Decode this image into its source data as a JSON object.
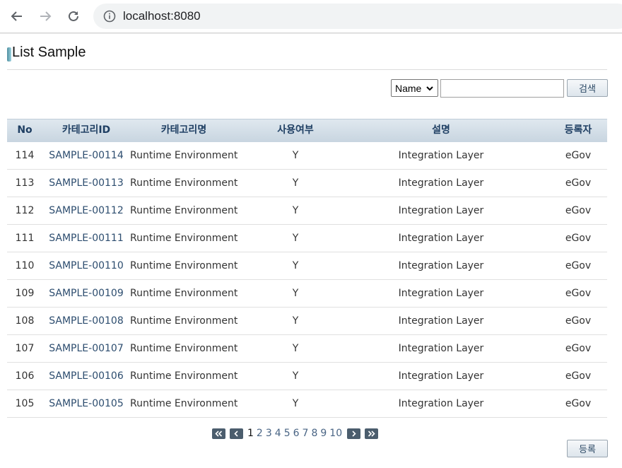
{
  "browser": {
    "url": "localhost:8080",
    "icons": {
      "back": "arrow-left-icon",
      "forward": "arrow-right-icon",
      "reload": "reload-icon",
      "info": "info-icon"
    }
  },
  "page": {
    "title": "List Sample"
  },
  "search": {
    "condition_selected": "Name",
    "keyword_value": "",
    "button_label": "검색"
  },
  "table": {
    "headers": [
      "No",
      "카테고리ID",
      "카테고리명",
      "사용여부",
      "설명",
      "등록자"
    ],
    "rows": [
      {
        "no": "114",
        "id": "SAMPLE-00114",
        "name": "Runtime Environment",
        "use": "Y",
        "desc": "Integration Layer",
        "reg": "eGov"
      },
      {
        "no": "113",
        "id": "SAMPLE-00113",
        "name": "Runtime Environment",
        "use": "Y",
        "desc": "Integration Layer",
        "reg": "eGov"
      },
      {
        "no": "112",
        "id": "SAMPLE-00112",
        "name": "Runtime Environment",
        "use": "Y",
        "desc": "Integration Layer",
        "reg": "eGov"
      },
      {
        "no": "111",
        "id": "SAMPLE-00111",
        "name": "Runtime Environment",
        "use": "Y",
        "desc": "Integration Layer",
        "reg": "eGov"
      },
      {
        "no": "110",
        "id": "SAMPLE-00110",
        "name": "Runtime Environment",
        "use": "Y",
        "desc": "Integration Layer",
        "reg": "eGov"
      },
      {
        "no": "109",
        "id": "SAMPLE-00109",
        "name": "Runtime Environment",
        "use": "Y",
        "desc": "Integration Layer",
        "reg": "eGov"
      },
      {
        "no": "108",
        "id": "SAMPLE-00108",
        "name": "Runtime Environment",
        "use": "Y",
        "desc": "Integration Layer",
        "reg": "eGov"
      },
      {
        "no": "107",
        "id": "SAMPLE-00107",
        "name": "Runtime Environment",
        "use": "Y",
        "desc": "Integration Layer",
        "reg": "eGov"
      },
      {
        "no": "106",
        "id": "SAMPLE-00106",
        "name": "Runtime Environment",
        "use": "Y",
        "desc": "Integration Layer",
        "reg": "eGov"
      },
      {
        "no": "105",
        "id": "SAMPLE-00105",
        "name": "Runtime Environment",
        "use": "Y",
        "desc": "Integration Layer",
        "reg": "eGov"
      }
    ]
  },
  "pagination": {
    "pages": [
      "1",
      "2",
      "3",
      "4",
      "5",
      "6",
      "7",
      "8",
      "9",
      "10"
    ],
    "current": "1",
    "icons": {
      "first": "double-chevron-left-icon",
      "prev": "chevron-left-icon",
      "next": "chevron-right-icon",
      "last": "double-chevron-right-icon"
    }
  },
  "actions": {
    "register_label": "등록"
  },
  "colors": {
    "header_text": "#1f3f63",
    "link_text": "#2d4d6f",
    "pager_button": "#4b5d6d"
  }
}
